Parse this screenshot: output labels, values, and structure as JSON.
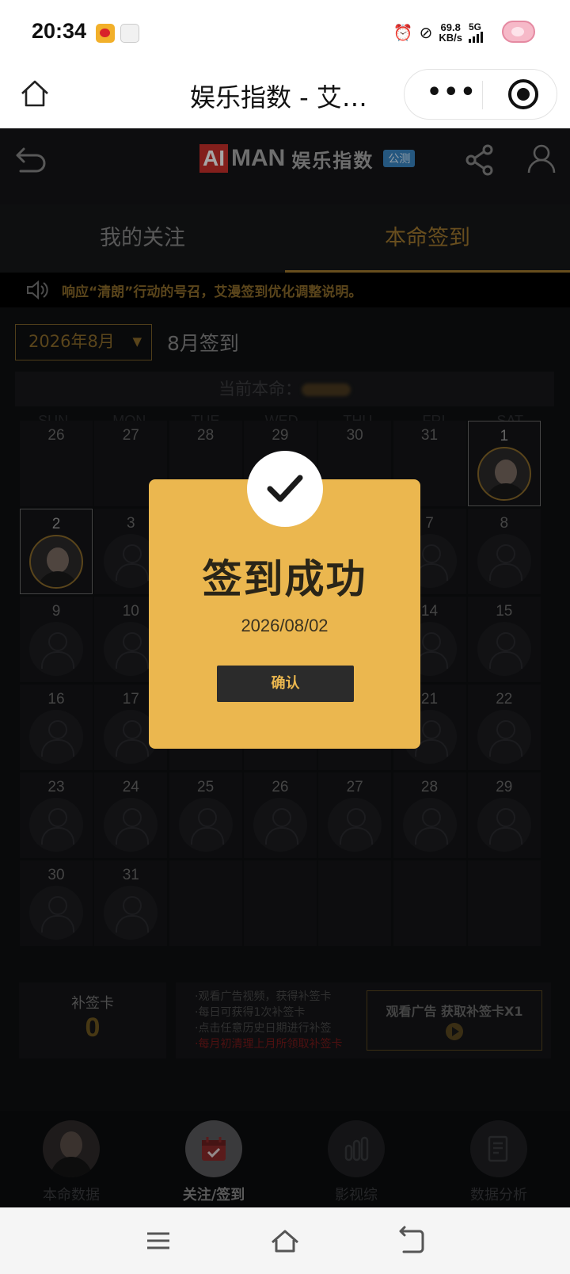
{
  "status_bar": {
    "time": "20:34",
    "net_speed_value": "69.8",
    "net_speed_unit": "KB/s",
    "network": "5G"
  },
  "title_bar": {
    "title": "娱乐指数 - 艾…",
    "more_label": "•••"
  },
  "app_header": {
    "logo_ai": "AI",
    "logo_man": "MAN",
    "logo_cn": "娱乐指数",
    "logo_badge": "公测"
  },
  "tabs": [
    {
      "label": "我的关注",
      "active": false
    },
    {
      "label": "本命签到",
      "active": true
    }
  ],
  "notice": "响应“清朗”行动的号召，艾漫签到优化调整说明。",
  "month_select": {
    "value": "2026年8月",
    "arrow": "▼"
  },
  "month_label": "8月签到",
  "current_label": "当前本命：",
  "weekdays": [
    "SUN",
    "MON",
    "TUE",
    "WED",
    "THU",
    "FRI",
    "SAT"
  ],
  "calendar": {
    "rows": [
      [
        "26",
        "27",
        "28",
        "29",
        "30",
        "31",
        "1"
      ],
      [
        "2",
        "3",
        "",
        "",
        "",
        "7",
        "8"
      ],
      [
        "9",
        "10",
        "",
        "",
        "",
        "14",
        "15"
      ],
      [
        "16",
        "17",
        "",
        "",
        "",
        "21",
        "22"
      ],
      [
        "23",
        "24",
        "25",
        "26",
        "27",
        "28",
        "29"
      ],
      [
        "30",
        "31",
        "",
        "",
        "",
        "",
        ""
      ]
    ],
    "checked_days": [
      "1",
      "2"
    ]
  },
  "makeup_card": {
    "label": "补签卡",
    "count": "0"
  },
  "info_lines": [
    "·观看广告视频，获得补签卡",
    "·每日可获得1次补签卡",
    "·点击任意历史日期进行补签"
  ],
  "info_warning": "·每月初清理上月所领取补签卡",
  "ad_button": "观看广告 获取补签卡X1",
  "bottom_nav": [
    {
      "label": "本命数据",
      "icon": "avatar-icon",
      "active": false
    },
    {
      "label": "关注/签到",
      "icon": "calendar-check-icon",
      "active": true
    },
    {
      "label": "影视综",
      "icon": "bar-chart-icon",
      "active": false
    },
    {
      "label": "数据分析",
      "icon": "document-icon",
      "active": false
    }
  ],
  "modal": {
    "title": "签到成功",
    "date": "2026/08/02",
    "confirm": "确认"
  },
  "colors": {
    "accent_gold": "#ebb74f",
    "tab_active": "#a0782e",
    "background": "#0f1012"
  }
}
